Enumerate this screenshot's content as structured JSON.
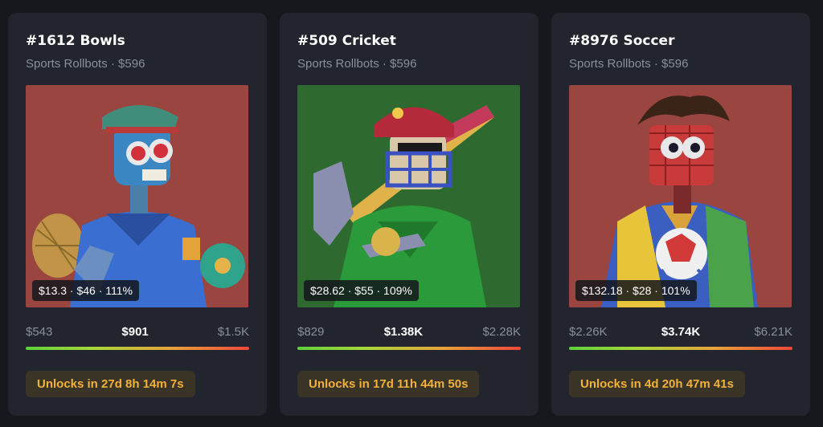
{
  "cards": [
    {
      "title": "#1612 Bowls",
      "subtitle": "Sports Rollbots · $596",
      "stats": "$13.3 · $46 · 111%",
      "range_low": "$543",
      "range_mid": "$901",
      "range_high": "$1.5K",
      "unlock": "Unlocks in 27d 8h 14m 7s",
      "bg_color": "#9a4540"
    },
    {
      "title": "#509 Cricket",
      "subtitle": "Sports Rollbots · $596",
      "stats": "$28.62 · $55 · 109%",
      "range_low": "$829",
      "range_mid": "$1.38K",
      "range_high": "$2.28K",
      "unlock": "Unlocks in 17d 11h 44m 50s",
      "bg_color": "#2e6a2f"
    },
    {
      "title": "#8976 Soccer",
      "subtitle": "Sports Rollbots · $596",
      "stats": "$132.18 · $28 · 101%",
      "range_low": "$2.26K",
      "range_mid": "$3.74K",
      "range_high": "$6.21K",
      "unlock": "Unlocks in 4d 20h 47m 41s",
      "bg_color": "#9a4540"
    }
  ],
  "theme": {
    "page_bg": "#16181e",
    "card_bg": "#22252e",
    "unlock_text": "#f2b13a",
    "unlock_bg": "#3a3427"
  },
  "icons": {
    "card1_art": "robot-bowls-art",
    "card2_art": "robot-cricket-art",
    "card3_art": "robot-soccer-art"
  }
}
